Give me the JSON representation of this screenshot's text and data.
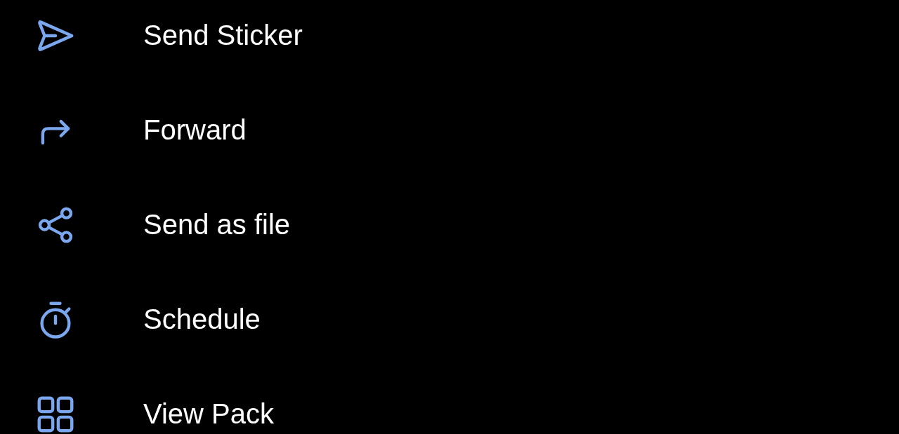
{
  "menu": {
    "items": [
      {
        "label": "Send Sticker"
      },
      {
        "label": "Forward"
      },
      {
        "label": "Send as file"
      },
      {
        "label": "Schedule"
      },
      {
        "label": "View Pack"
      }
    ]
  }
}
